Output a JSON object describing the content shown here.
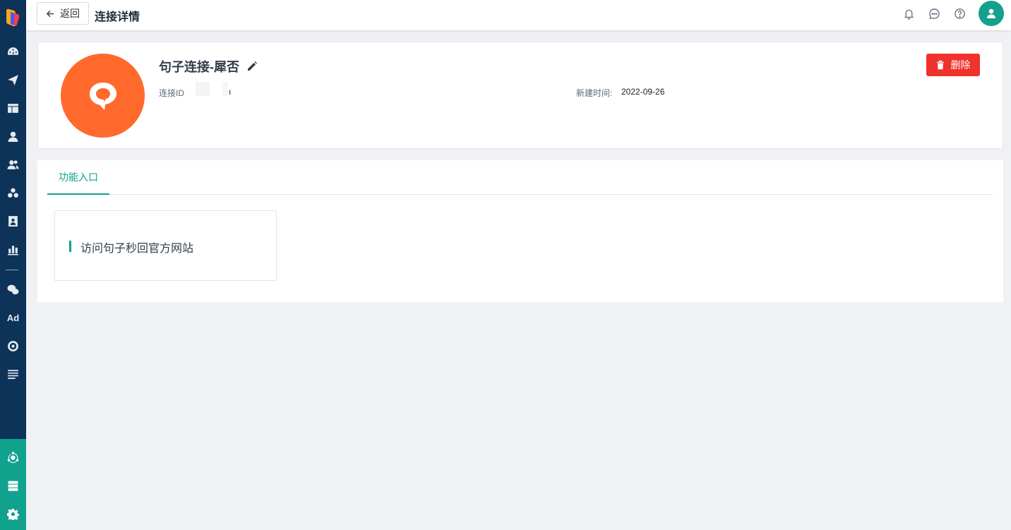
{
  "header": {
    "back_label": "返回",
    "title": "连接详情",
    "icons": [
      "bell-icon",
      "message-icon",
      "help-icon",
      "user-avatar"
    ]
  },
  "sidebar": {
    "items": [
      "dashboard-icon",
      "send-icon",
      "layout-icon",
      "user-icon",
      "users-icon",
      "cluster-icon",
      "contact-card-icon",
      "bar-chart-icon",
      "wechat-icon",
      "ad-icon",
      "circle-icon",
      "list-icon"
    ],
    "ad_label": "Ad",
    "bottom_items": [
      "integration-icon",
      "server-icon",
      "settings-icon"
    ]
  },
  "connection": {
    "name": "句子连接-犀否",
    "id_label": "连接ID",
    "id_value": "",
    "id_trailing": "ı",
    "created_label": "新建时间:",
    "created_value": "2022-09-26",
    "delete_label": "删除",
    "logo_color": "#ff6a2c"
  },
  "tabs": [
    {
      "label": "功能入口",
      "active": true
    }
  ],
  "entries": [
    {
      "label": "访问句子秒回官方网站"
    }
  ],
  "colors": {
    "accent": "#11a28e",
    "sidebar": "#0d3358",
    "danger": "#f0322c"
  }
}
